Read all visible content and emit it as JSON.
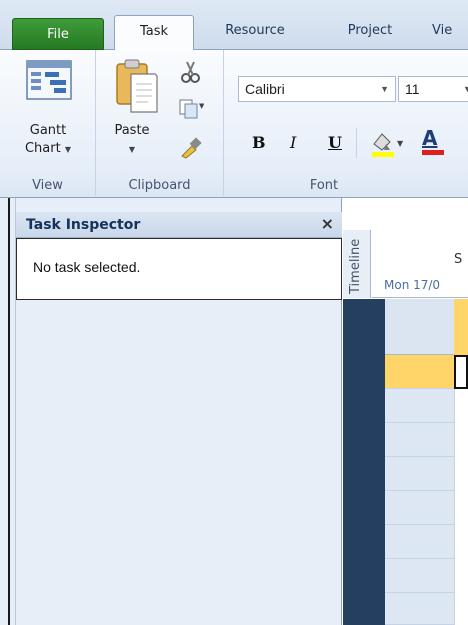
{
  "tabs": {
    "file": "File",
    "task": "Task",
    "resource": "Resource",
    "project": "Project",
    "view": "Vie"
  },
  "ribbon": {
    "view_group": {
      "label": "View",
      "gantt_line1": "Gantt",
      "gantt_line2": "Chart"
    },
    "clipboard_group": {
      "label": "Clipboard",
      "paste": "Paste"
    },
    "font_group": {
      "label": "Font",
      "font_name": "Calibri",
      "font_size": "11",
      "bold": "B",
      "italic": "I",
      "underline": "U",
      "font_color_letter": "A"
    }
  },
  "inspector": {
    "title": "Task Inspector",
    "close": "×",
    "message": "No task selected."
  },
  "timeline": {
    "label": "Timeline",
    "partial_char": "S",
    "date": "Mon 17/0"
  },
  "colors": {
    "file_tab": "#2e8b2a",
    "highlight": "#ffd56a",
    "grid_dark": "#243f60"
  }
}
